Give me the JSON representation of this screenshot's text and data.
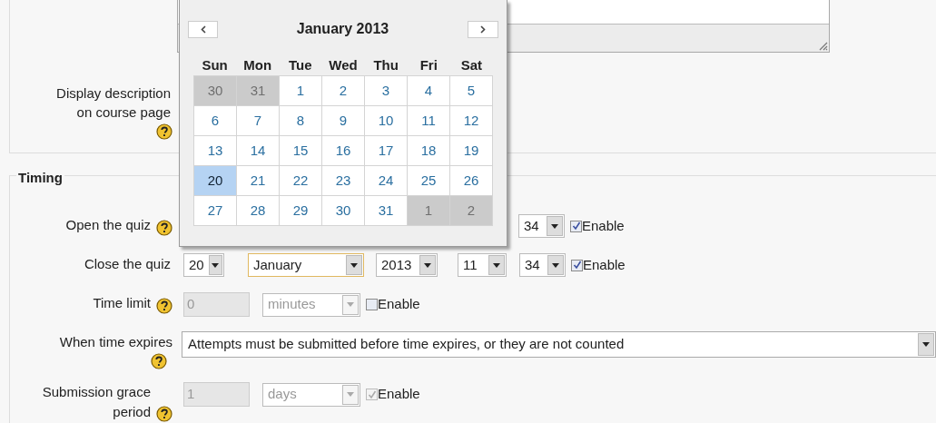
{
  "description_setting": {
    "label": "Display description on course page",
    "help": true
  },
  "timing": {
    "legend": "Timing",
    "rows": [
      {
        "kind": "datetime",
        "label": "Open the quiz",
        "help": true,
        "covered_by_calendar": true,
        "fields": [
          {
            "value": "34",
            "focused": false
          }
        ],
        "enable": {
          "label": "Enable",
          "checked": true,
          "disabled": false
        }
      },
      {
        "kind": "datetime",
        "label": "Close the quiz",
        "help": false,
        "covered_by_calendar": false,
        "fields": [
          {
            "value": "20",
            "focused": false
          },
          {
            "value": "January",
            "focused": true
          },
          {
            "value": "2013",
            "focused": false
          },
          {
            "value": "11",
            "focused": false
          },
          {
            "value": "34",
            "focused": false
          }
        ],
        "enable": {
          "label": "Enable",
          "checked": true,
          "disabled": false
        }
      },
      {
        "kind": "duration",
        "label": "Time limit",
        "help": true,
        "value": "0",
        "unit": "minutes",
        "disabled": true,
        "enable": {
          "label": "Enable",
          "checked": false,
          "disabled": false
        }
      },
      {
        "kind": "select",
        "label": "When time expires",
        "help": true,
        "value": "Attempts must be submitted before time expires, or they are not counted"
      },
      {
        "kind": "duration",
        "label": "Submission grace period",
        "help": true,
        "value": "1",
        "unit": "days",
        "disabled": true,
        "enable": {
          "label": "Enable",
          "checked": true,
          "disabled": true
        }
      }
    ]
  },
  "calendar": {
    "title": "January 2013",
    "weekdays": [
      "Sun",
      "Mon",
      "Tue",
      "Wed",
      "Thu",
      "Fri",
      "Sat"
    ],
    "weeks": [
      [
        {
          "day": "30",
          "outside": true,
          "selected": false
        },
        {
          "day": "31",
          "outside": true,
          "selected": false
        },
        {
          "day": "1",
          "outside": false,
          "selected": false
        },
        {
          "day": "2",
          "outside": false,
          "selected": false
        },
        {
          "day": "3",
          "outside": false,
          "selected": false
        },
        {
          "day": "4",
          "outside": false,
          "selected": false
        },
        {
          "day": "5",
          "outside": false,
          "selected": false
        }
      ],
      [
        {
          "day": "6",
          "outside": false,
          "selected": false
        },
        {
          "day": "7",
          "outside": false,
          "selected": false
        },
        {
          "day": "8",
          "outside": false,
          "selected": false
        },
        {
          "day": "9",
          "outside": false,
          "selected": false
        },
        {
          "day": "10",
          "outside": false,
          "selected": false
        },
        {
          "day": "11",
          "outside": false,
          "selected": false
        },
        {
          "day": "12",
          "outside": false,
          "selected": false
        }
      ],
      [
        {
          "day": "13",
          "outside": false,
          "selected": false
        },
        {
          "day": "14",
          "outside": false,
          "selected": false
        },
        {
          "day": "15",
          "outside": false,
          "selected": false
        },
        {
          "day": "16",
          "outside": false,
          "selected": false
        },
        {
          "day": "17",
          "outside": false,
          "selected": false
        },
        {
          "day": "18",
          "outside": false,
          "selected": false
        },
        {
          "day": "19",
          "outside": false,
          "selected": false
        }
      ],
      [
        {
          "day": "20",
          "outside": false,
          "selected": true
        },
        {
          "day": "21",
          "outside": false,
          "selected": false
        },
        {
          "day": "22",
          "outside": false,
          "selected": false
        },
        {
          "day": "23",
          "outside": false,
          "selected": false
        },
        {
          "day": "24",
          "outside": false,
          "selected": false
        },
        {
          "day": "25",
          "outside": false,
          "selected": false
        },
        {
          "day": "26",
          "outside": false,
          "selected": false
        }
      ],
      [
        {
          "day": "27",
          "outside": false,
          "selected": false
        },
        {
          "day": "28",
          "outside": false,
          "selected": false
        },
        {
          "day": "29",
          "outside": false,
          "selected": false
        },
        {
          "day": "30",
          "outside": false,
          "selected": false
        },
        {
          "day": "31",
          "outside": false,
          "selected": false
        },
        {
          "day": "1",
          "outside": true,
          "selected": false
        },
        {
          "day": "2",
          "outside": true,
          "selected": false
        }
      ]
    ]
  }
}
